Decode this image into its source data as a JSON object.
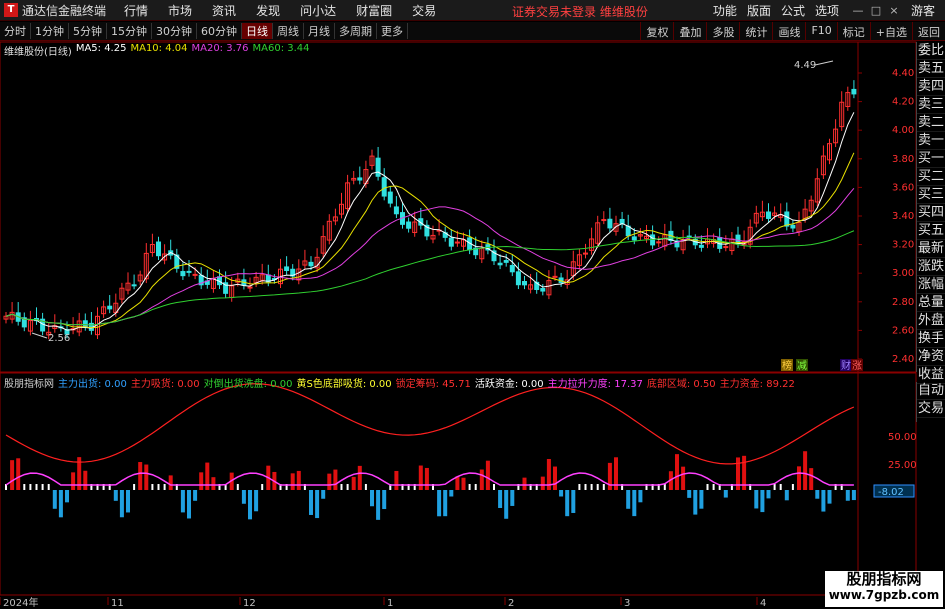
{
  "menubar": {
    "app_name": "通达信金融终端",
    "logo_text": "T",
    "items": [
      "行情",
      "市场",
      "资讯",
      "发现",
      "问小达",
      "财富圈",
      "交易"
    ],
    "login_status": "证券交易未登录   维维股份",
    "right_items": [
      "功能",
      "版面",
      "公式",
      "选项",
      "游客"
    ],
    "win_buttons": [
      "—",
      "□",
      "×"
    ]
  },
  "periodbar": {
    "periods": [
      "分时",
      "1分钟",
      "5分钟",
      "15分钟",
      "30分钟",
      "60分钟",
      "日线",
      "周线",
      "月线",
      "多周期",
      "更多"
    ],
    "active": "日线",
    "tools": [
      "复权",
      "叠加",
      "多股",
      "统计",
      "画线",
      "F10",
      "标记",
      "+自选",
      "返回"
    ]
  },
  "main_chart": {
    "legend": {
      "title": "维维股份(日线)",
      "ma5": "MA5: 4.25",
      "ma10": "MA10: 4.04",
      "ma20": "MA20: 3.76",
      "ma60": "MA60: 3.44"
    },
    "price_labels": [
      "4.40",
      "4.20",
      "4.00",
      "3.80",
      "3.60",
      "3.40",
      "3.20",
      "3.00",
      "2.80",
      "2.60",
      "2.40"
    ],
    "high_label": "4.49",
    "low_label": "2.56",
    "badges": [
      "榜",
      "减",
      "财",
      "涨"
    ],
    "colors": {
      "ma5": "#ffffff",
      "ma10": "#e8e000",
      "ma20": "#e040e0",
      "ma60": "#30d030",
      "up": "#ff3030",
      "down": "#30e0e0"
    }
  },
  "indicator": {
    "legend": [
      {
        "text": "股朋指标网",
        "color": "#d0d0d0"
      },
      {
        "text": "主力出货: 0.00",
        "color": "#30a0ff"
      },
      {
        "text": "主力吸货: 0.00",
        "color": "#ff3030"
      },
      {
        "text": "对倒出货洗盘: 0.00",
        "color": "#30d030"
      },
      {
        "text": "黄S色底部吸货: 0.00",
        "color": "#ffff30"
      },
      {
        "text": "锁定筹码: 45.71",
        "color": "#ff3030"
      },
      {
        "text": "活跃资金: 0.00",
        "color": "#ffffff"
      },
      {
        "text": "主力拉升力度: 17.37",
        "color": "#ff40ff"
      },
      {
        "text": "底部区域: 0.50",
        "color": "#ff3030"
      },
      {
        "text": "主力资金: 89.22",
        "color": "#ff3030"
      }
    ],
    "axis_labels": [
      "50.00",
      "25.00"
    ],
    "current_value": "-8.02"
  },
  "time_axis": [
    "2024年",
    "11",
    "12",
    "1",
    "2",
    "3",
    "4"
  ],
  "right_panel": [
    "委比",
    "卖五",
    "卖四",
    "卖三",
    "卖二",
    "卖一",
    "买一",
    "买二",
    "买三",
    "买四",
    "买五",
    "最新",
    "涨跌",
    "涨幅",
    "总量",
    "外盘",
    "换手",
    "净资",
    "收益"
  ],
  "right_panel2": [
    "自动",
    "交易"
  ],
  "watermark": {
    "line1": "股朋指标网",
    "line2": "www.7gpzb.com"
  }
}
